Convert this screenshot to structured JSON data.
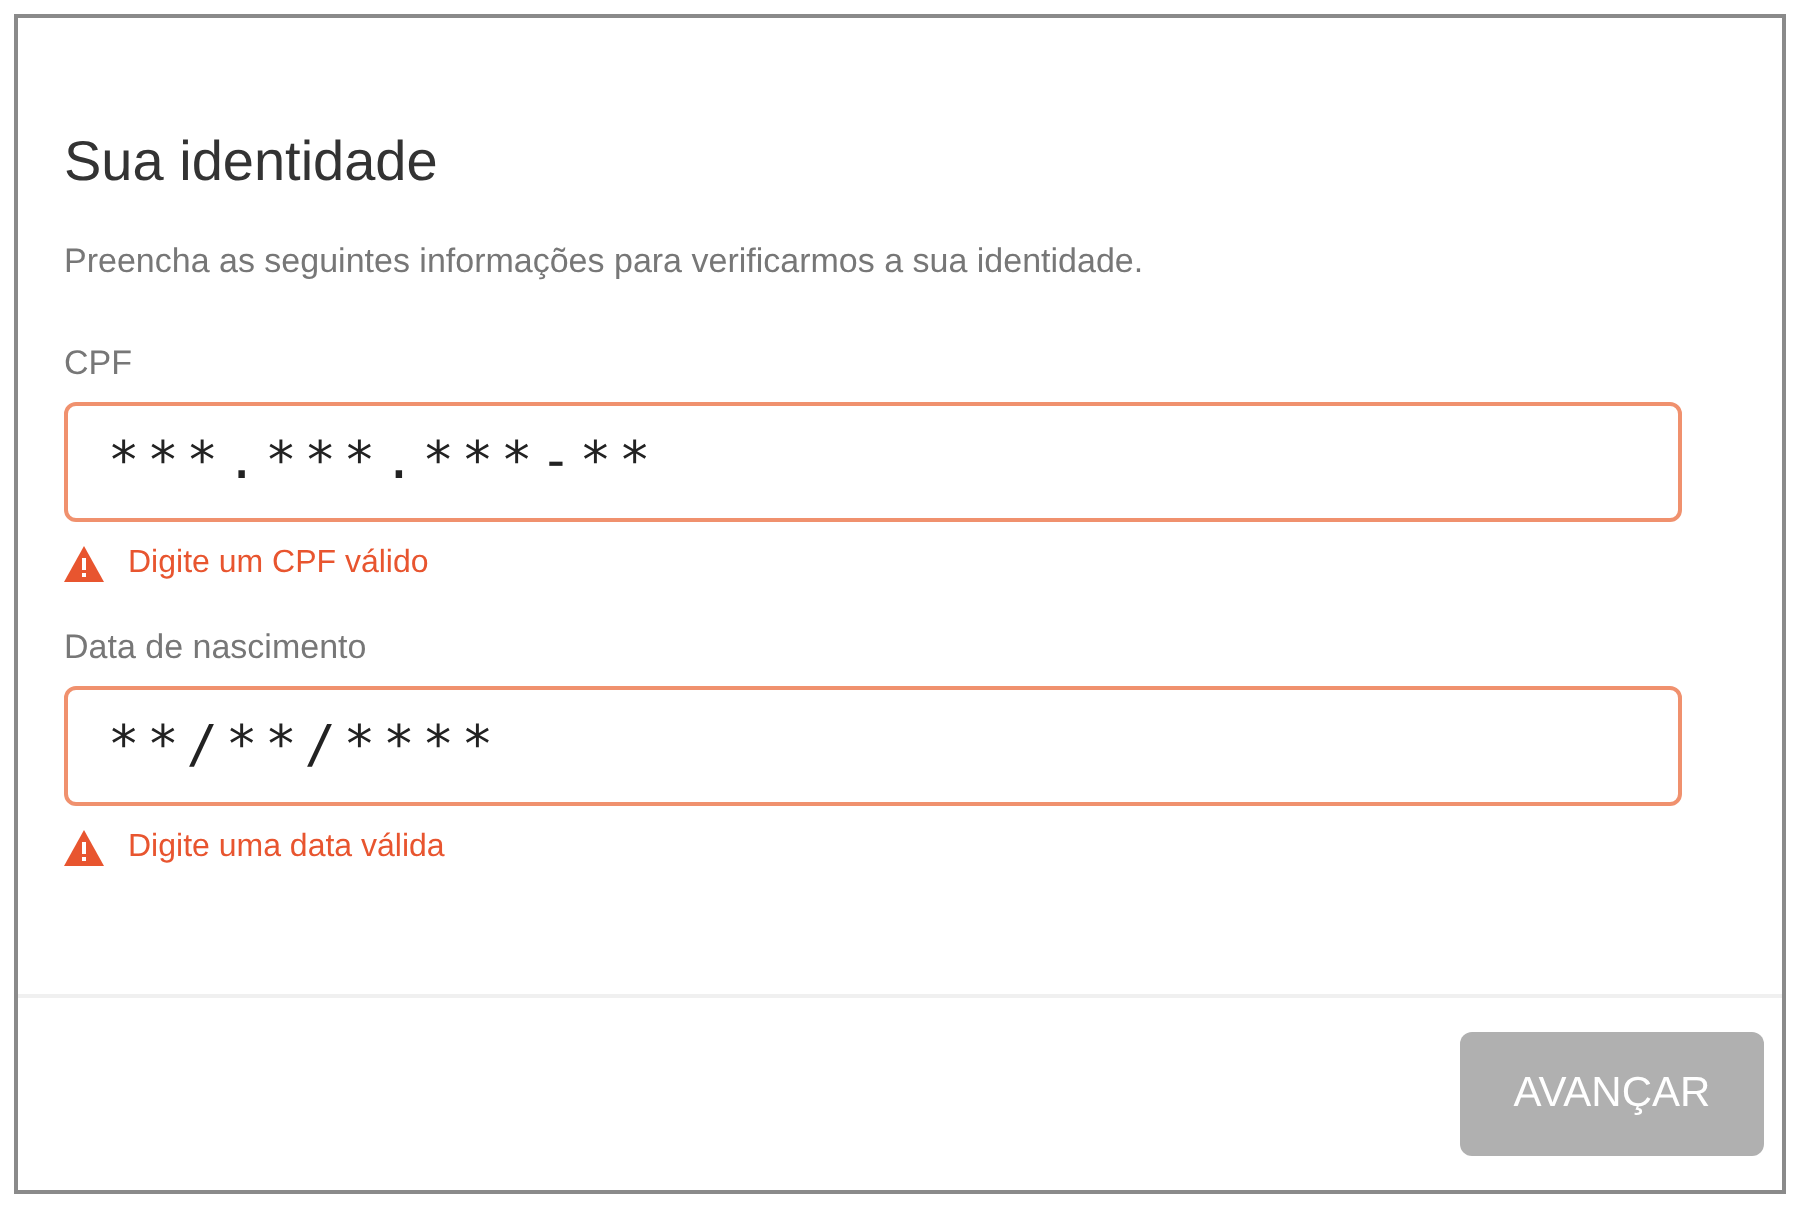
{
  "dialog": {
    "title": "Sua identidade",
    "description": "Preencha as seguintes informações para verificarmos a sua identidade."
  },
  "fields": [
    {
      "label": "CPF",
      "value": "***.***.***-**",
      "invalid": true,
      "error": "Digite um CPF válido"
    },
    {
      "label": "Data de nascimento",
      "value": "**/**/****",
      "invalid": true,
      "error": "Digite uma data válida"
    }
  ],
  "buttons": [
    {
      "label": "AVANÇAR",
      "disabled": true
    }
  ]
}
